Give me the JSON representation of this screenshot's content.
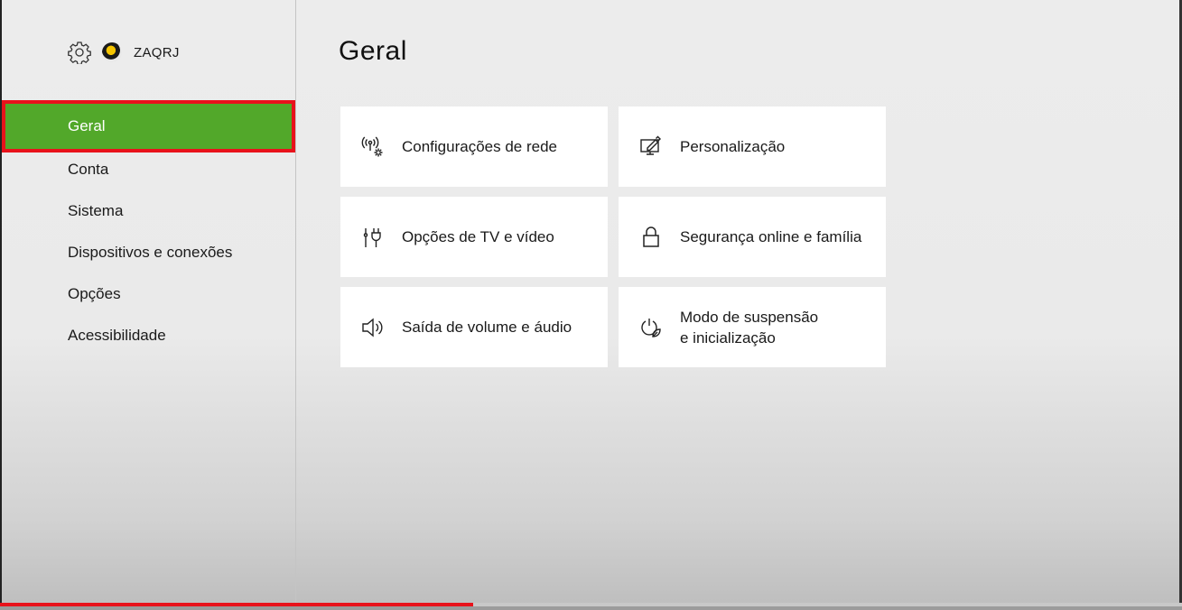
{
  "profile": {
    "settings_icon": "gear-icon",
    "avatar_icon": "avatar-icon",
    "gamertag": "ZAQRJ"
  },
  "sidebar": {
    "items": [
      {
        "label": "Geral",
        "selected": true
      },
      {
        "label": "Conta"
      },
      {
        "label": "Sistema"
      },
      {
        "label": "Dispositivos e conexões"
      },
      {
        "label": "Opções"
      },
      {
        "label": "Acessibilidade"
      }
    ]
  },
  "main": {
    "title": "Geral",
    "tiles": [
      {
        "icon": "network-icon",
        "label": "Configurações de rede"
      },
      {
        "icon": "personalization-icon",
        "label": "Personalização"
      },
      {
        "icon": "tv-plug-icon",
        "label": "Opções de TV e vídeo"
      },
      {
        "icon": "lock-icon",
        "label": "Segurança online e família"
      },
      {
        "icon": "speaker-icon",
        "label": "Saída de volume e áudio"
      },
      {
        "icon": "power-leaf-icon",
        "label_line1": "Modo de suspensão",
        "label_line2": "e inicialização"
      }
    ]
  },
  "colors": {
    "accent_green": "#52a82a",
    "highlight_red": "#e8121b",
    "tile_bg": "#ffffff"
  },
  "video_progress": 0.4
}
